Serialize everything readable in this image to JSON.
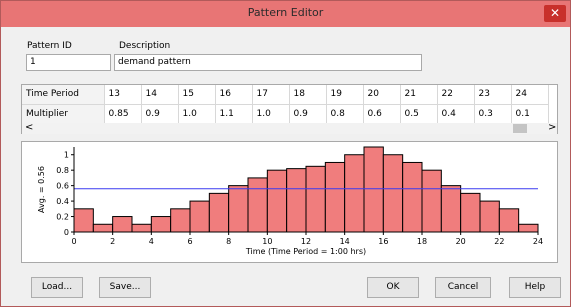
{
  "window": {
    "title": "Pattern Editor",
    "close_glyph": "✕"
  },
  "pattern_id": {
    "label": "Pattern ID",
    "value": "1"
  },
  "description": {
    "label": "Description",
    "value": "demand pattern"
  },
  "grid": {
    "row_headers": [
      "Time Period",
      "Multiplier"
    ],
    "time_periods": [
      "13",
      "14",
      "15",
      "16",
      "17",
      "18",
      "19",
      "20",
      "21",
      "22",
      "23",
      "24"
    ],
    "multipliers": [
      "0.85",
      "0.9",
      "1.0",
      "1.1",
      "1.0",
      "0.9",
      "0.8",
      "0.6",
      "0.5",
      "0.4",
      "0.3",
      "0.1"
    ],
    "scroll_left": "<",
    "scroll_right": ">"
  },
  "chart_data": {
    "type": "bar",
    "ylabel": "Avg. = 0.56",
    "xlabel": "Time (Time Period = 1:00 hrs)",
    "xlim": [
      0,
      24
    ],
    "ylim": [
      0,
      1.1
    ],
    "x_ticks": [
      "0",
      "2",
      "4",
      "6",
      "8",
      "10",
      "12",
      "14",
      "16",
      "18",
      "20",
      "22",
      "24"
    ],
    "y_ticks": [
      "0",
      "0.2",
      "0.4",
      "0.6",
      "0.8",
      "1"
    ],
    "values": [
      0.3,
      0.1,
      0.2,
      0.1,
      0.2,
      0.3,
      0.4,
      0.5,
      0.6,
      0.7,
      0.8,
      0.82,
      0.85,
      0.9,
      1.0,
      1.1,
      1.0,
      0.9,
      0.8,
      0.6,
      0.5,
      0.4,
      0.3,
      0.1
    ],
    "average": 0.56,
    "bar_color": "#f07d7d",
    "average_color": "#3a3af0"
  },
  "buttons": {
    "load": "Load...",
    "save": "Save...",
    "ok": "OK",
    "cancel": "Cancel",
    "help": "Help"
  }
}
